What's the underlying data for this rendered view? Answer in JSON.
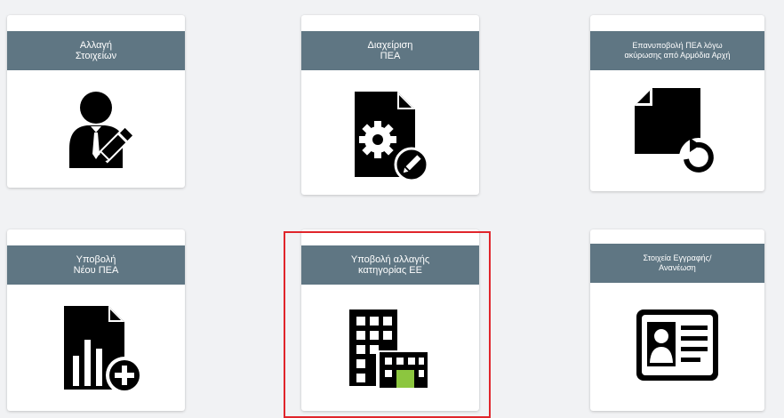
{
  "tiles": [
    {
      "id": "change-details",
      "title": "Αλλαγή\nΣτοιχείων",
      "icon": "user-edit-icon"
    },
    {
      "id": "manage-pea",
      "title": "Διαχείριση\nΠΕΑ",
      "icon": "document-settings-icon"
    },
    {
      "id": "resubmit-pea",
      "title": "Επανυποβολή ΠΕΑ λόγω\nακύρωσης από Αρμόδια Αρχή",
      "icon": "document-resubmit-icon"
    },
    {
      "id": "submit-new-pea",
      "title": "Υποβολή\nΝέου ΠΕΑ",
      "icon": "document-chart-add-icon"
    },
    {
      "id": "submit-category-change",
      "title": "Υποβολή αλλαγής\nκατηγορίας ΕΕ",
      "icon": "buildings-icon",
      "highlighted": true
    },
    {
      "id": "registration-details",
      "title": "Στοιχεία Εγγραφής/\nΑνανέωση",
      "icon": "id-card-icon"
    }
  ],
  "colors": {
    "header": "#5f7683",
    "highlight": "#e0252b",
    "accent_green": "#8cc63f"
  }
}
